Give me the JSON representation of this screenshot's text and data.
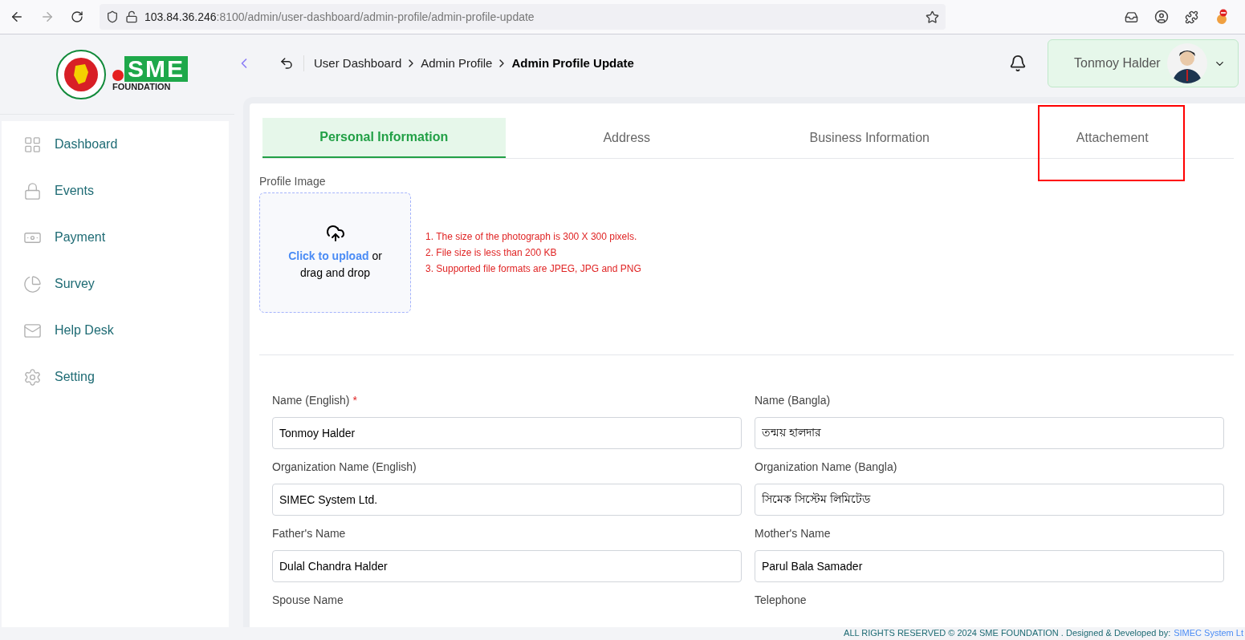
{
  "browser": {
    "url_host": "103.84.36.246",
    "url_rest": ":8100/admin/user-dashboard/admin-profile/admin-profile-update"
  },
  "logo": {
    "mark": "SME",
    "subtitle": "FOUNDATION"
  },
  "breadcrumb": [
    {
      "label": "User Dashboard",
      "current": false
    },
    {
      "label": "Admin Profile",
      "current": false
    },
    {
      "label": "Admin Profile Update",
      "current": true
    }
  ],
  "user": {
    "name": "Tonmoy Halder"
  },
  "sidebar": {
    "items": [
      {
        "label": "Dashboard"
      },
      {
        "label": "Events"
      },
      {
        "label": "Payment"
      },
      {
        "label": "Survey"
      },
      {
        "label": "Help Desk"
      },
      {
        "label": "Setting"
      }
    ]
  },
  "tabs": [
    {
      "label": "Personal Information",
      "selected": true,
      "highlighted": false
    },
    {
      "label": "Address",
      "selected": false,
      "highlighted": false
    },
    {
      "label": "Business Information",
      "selected": false,
      "highlighted": false
    },
    {
      "label": "Attachement",
      "selected": false,
      "highlighted": true
    }
  ],
  "profile_image": {
    "label": "Profile Image",
    "upload_link": "Click to upload",
    "upload_rest": "or",
    "upload_line2": "drag and drop",
    "rules": [
      "1. The size of the photograph is 300 X 300 pixels.",
      "2. File size is less than 200 KB",
      "3. Supported file formats are JPEG, JPG and PNG"
    ]
  },
  "fields": [
    {
      "label": "Name (English)",
      "required_mark": "*",
      "value": "Tonmoy Halder"
    },
    {
      "label": "Name (Bangla)",
      "value": "তন্ময় হালদার"
    },
    {
      "label": "Organization Name (English)",
      "value": "SIMEC System Ltd."
    },
    {
      "label": "Organization Name (Bangla)",
      "value": "সিমেক সিস্টেম লিমিটেড"
    },
    {
      "label": "Father's Name",
      "value": "Dulal Chandra Halder"
    },
    {
      "label": "Mother's Name",
      "value": "Parul Bala Samader"
    },
    {
      "label": "Spouse Name"
    },
    {
      "label": "Telephone"
    }
  ],
  "footer": {
    "text": "ALL RIGHTS RESERVED © 2024 SME FOUNDATION . Designed & Developed by:",
    "link": "SIMEC System Lt"
  }
}
